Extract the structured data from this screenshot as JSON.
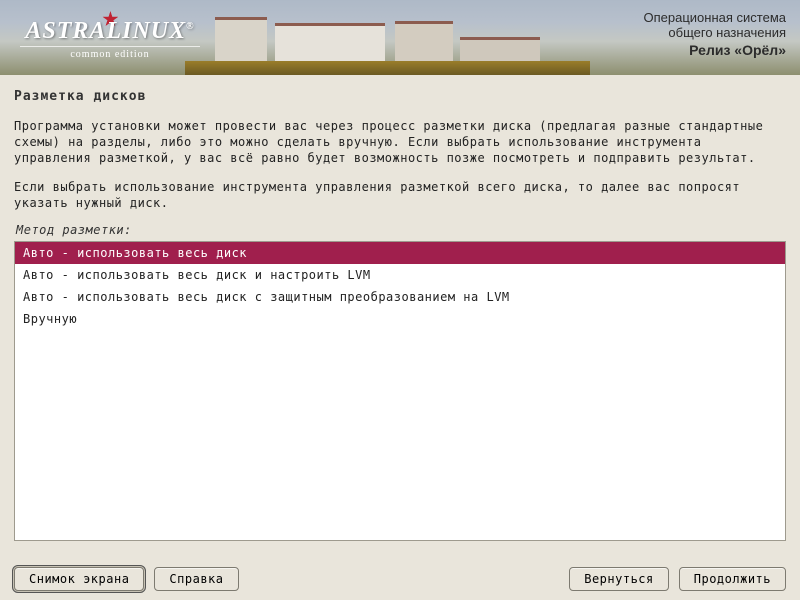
{
  "header": {
    "brand": "ASTRALINUX",
    "brand_suffix": "®",
    "tagline": "common edition",
    "line1": "Операционная система",
    "line2": "общего назначения",
    "line3": "Релиз «Орёл»"
  },
  "page": {
    "title": "Разметка дисков",
    "para1": "Программа установки может провести вас через процесс разметки диска (предлагая разные стандартные схемы) на разделы, либо это можно сделать вручную. Если выбрать использование инструмента управления разметкой, у вас всё равно будет возможность позже посмотреть и подправить результат.",
    "para2": "Если выбрать использование инструмента управления разметкой всего диска, то далее вас попросят указать нужный диск.",
    "method_label": "Метод разметки:"
  },
  "options": [
    "Авто - использовать весь диск",
    "Авто - использовать весь диск и настроить LVM",
    "Авто - использовать весь диск с защитным преобразованием на LVM",
    "Вручную"
  ],
  "selected_index": 0,
  "buttons": {
    "screenshot": "Снимок экрана",
    "help": "Справка",
    "back": "Вернуться",
    "continue": "Продолжить"
  }
}
